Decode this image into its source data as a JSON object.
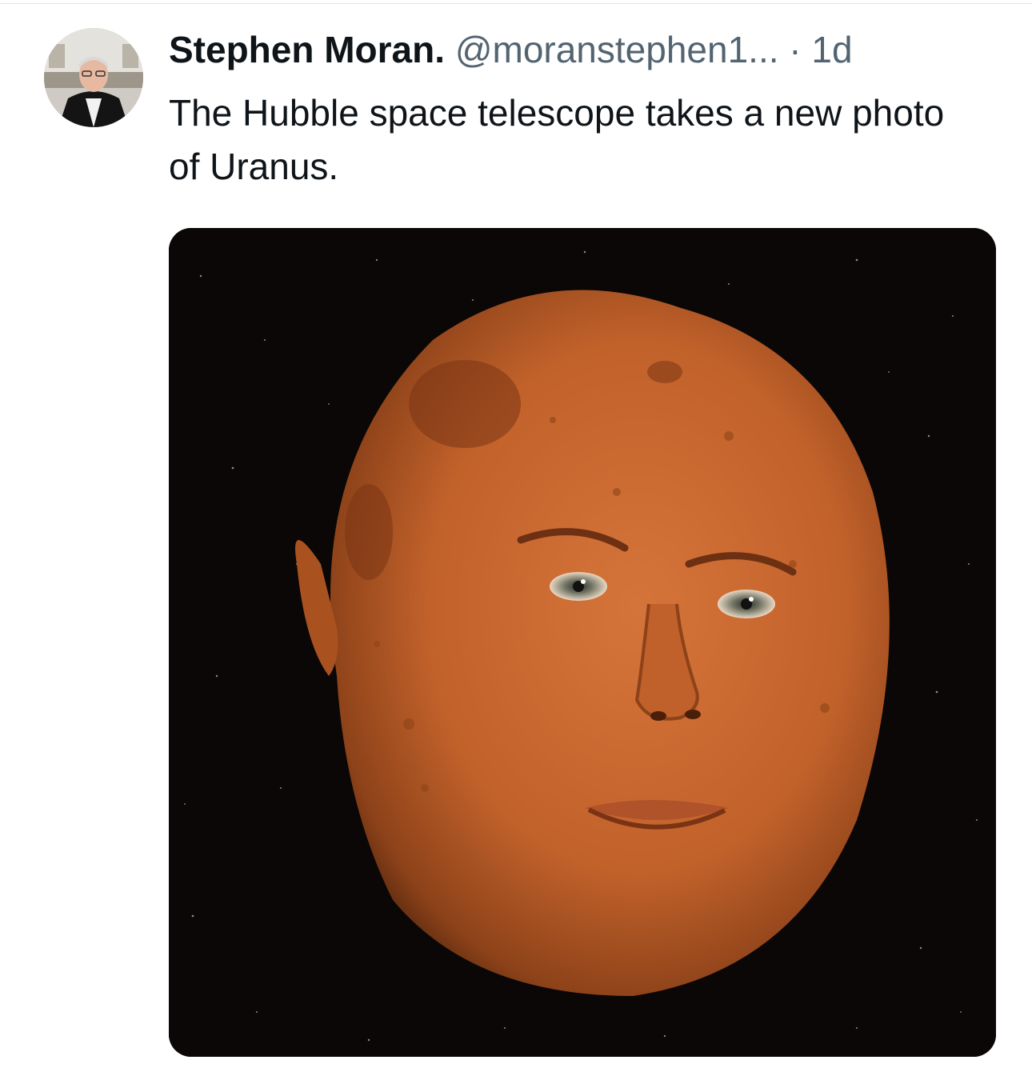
{
  "tweet": {
    "author": {
      "display_name": "Stephen Moran.",
      "handle": "@moranstephen1...",
      "avatar_icon": "profile-photo-avatar"
    },
    "separator": "·",
    "timestamp": "1d",
    "text": "The Hubble space telescope takes a new photo of Uranus.",
    "media": {
      "type": "photo",
      "subject": "orange cratered planet with a human face on a starfield background",
      "colors": {
        "background": "#0a0706",
        "planet": "#c8642a",
        "planet_shadow": "#7a3414"
      }
    }
  }
}
